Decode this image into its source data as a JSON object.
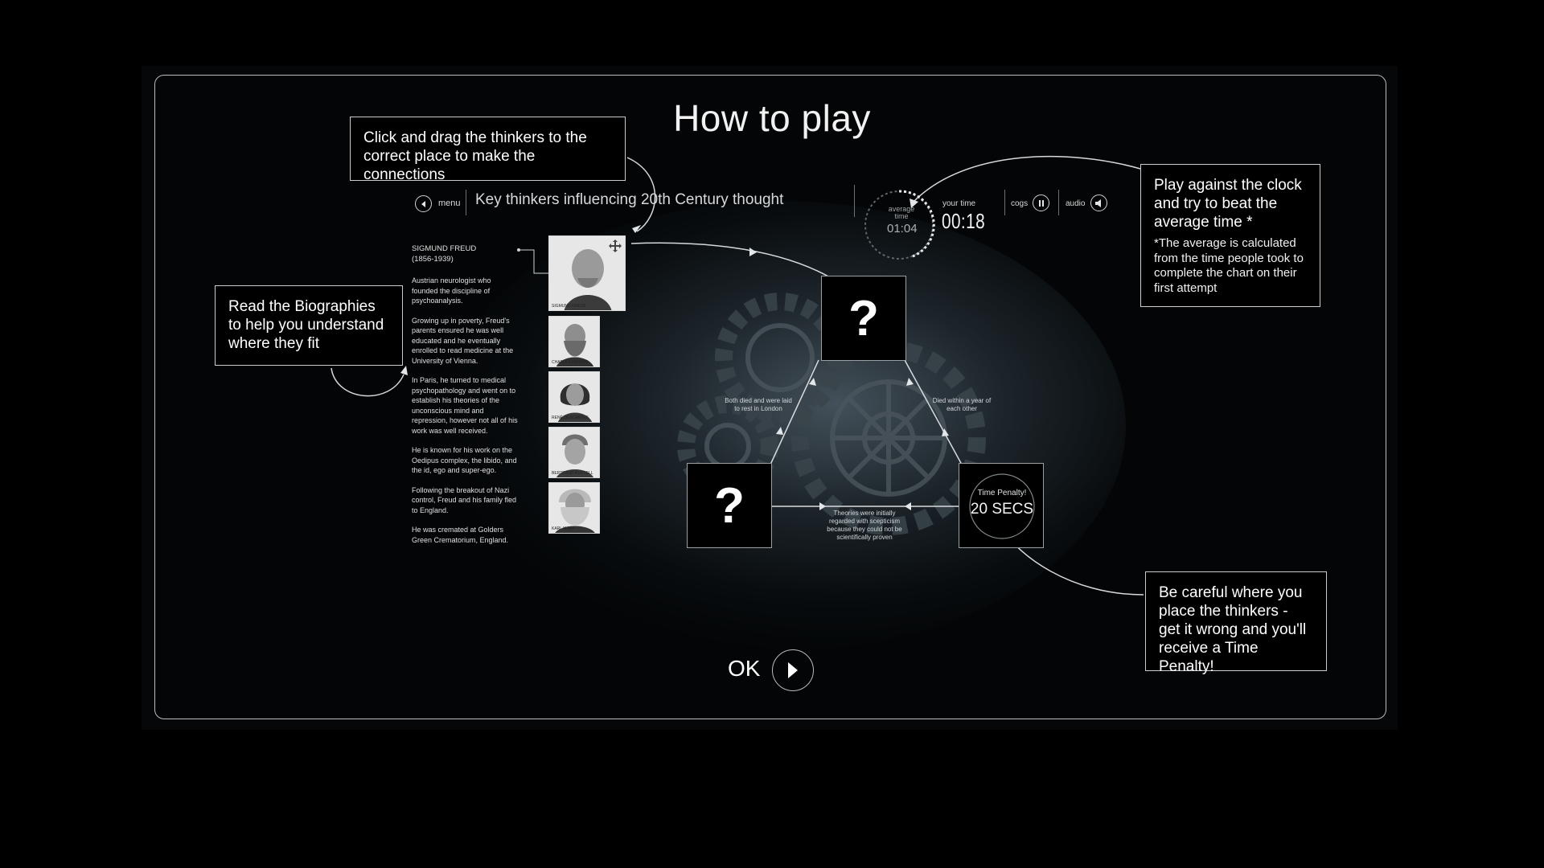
{
  "title": "How to play",
  "callouts": {
    "drag": "Click and drag the thinkers to the correct place to make the connections",
    "bios": "Read the Biographies to help you understand where they fit",
    "clock": "Play against the clock and try to beat the average time *",
    "clock_note": "*The average is calculated from the time people took to complete the chart on their first attempt",
    "penalty": "Be careful where you place the thinkers - get it wrong and you'll receive a Time Penalty!"
  },
  "toolbar": {
    "menu_label": "menu",
    "game_title": "Key thinkers influencing 20th Century thought",
    "average_time_label": "average time",
    "average_time": "01:04",
    "your_time_label": "your time",
    "your_time": "00:18",
    "cogs_label": "cogs",
    "audio_label": "audio"
  },
  "bio": {
    "name": "SIGMUND FREUD",
    "years": "(1856-1939)",
    "paragraphs": [
      "Austrian neurologist who founded the discipline of psychoanalysis.",
      "Growing up in poverty, Freud's parents ensured he was well educated and he eventually enrolled to read medicine at the University of Vienna.",
      "In Paris, he turned to medical psychopathology and went on to establish his theories of the unconscious mind and repression, however not all of his work was well received.",
      "He is known for his work on the Oedipus complex, the libido, and the id, ego and super-ego.",
      "Following the breakout of Nazi control, Freud and his family fled to England.",
      "He was cremated at Golders Green Crematorium, England."
    ]
  },
  "thinkers": [
    {
      "caption": "SIGMUND FREUD"
    },
    {
      "caption": "CHARLES DARWIN"
    },
    {
      "caption": "RENÉ DESCARTES"
    },
    {
      "caption": "BERTRAND RUSSELL"
    },
    {
      "caption": "KARL MARX"
    }
  ],
  "board": {
    "question_mark": "?",
    "link_left": "Both died and were laid to rest in London",
    "link_right": "Died within a year of each other",
    "link_bottom": "Theories were initially regarded with scepticism because they could not be scientifically proven",
    "penalty_label": "Time Penalty!",
    "penalty_value": "20 SECS"
  },
  "ok_label": "OK"
}
